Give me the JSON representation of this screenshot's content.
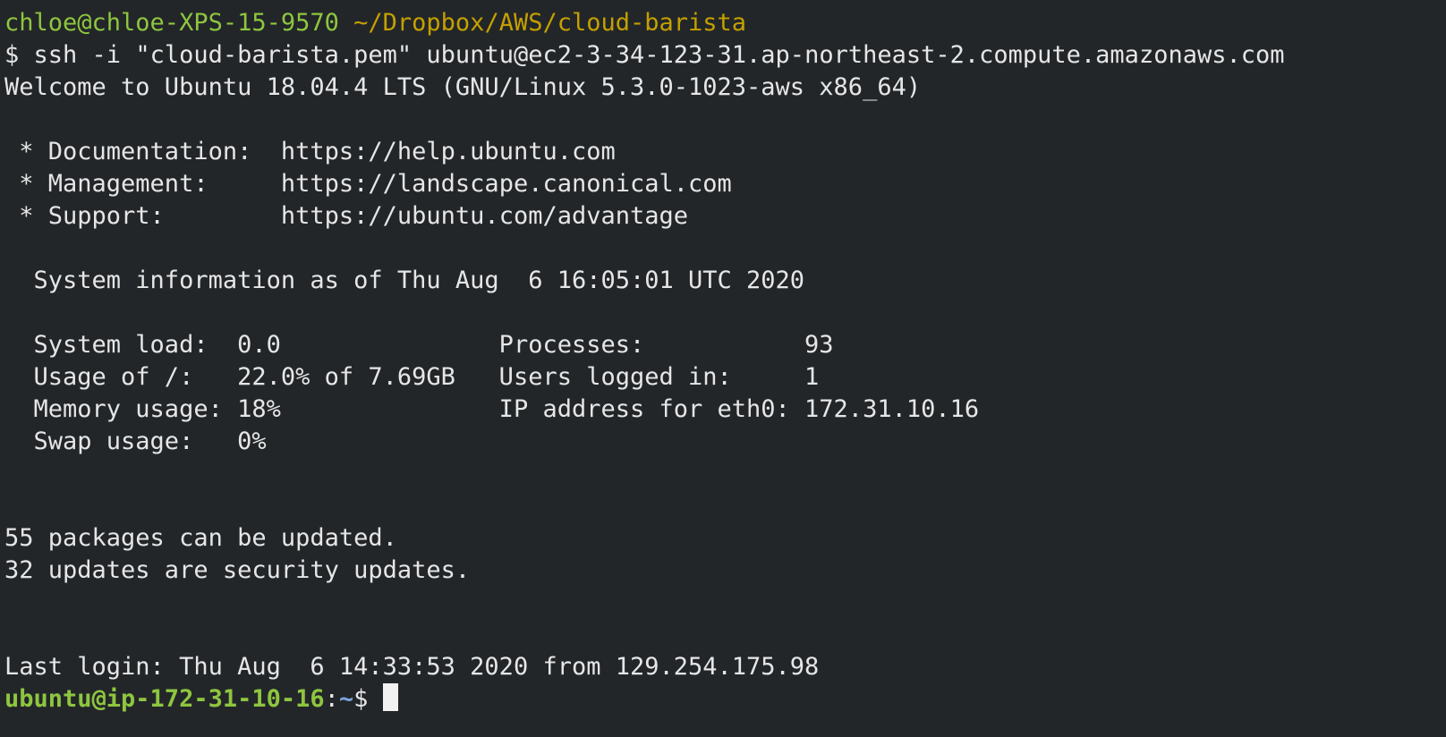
{
  "prompt_local": {
    "user_host": "chloe@chloe-XPS-15-9570",
    "path": "~/Dropbox/AWS/cloud-barista"
  },
  "command": {
    "symbol": "$",
    "text": "ssh -i \"cloud-barista.pem\" ubuntu@ec2-3-34-123-31.ap-northeast-2.compute.amazonaws.com"
  },
  "welcome": "Welcome to Ubuntu 18.04.4 LTS (GNU/Linux 5.3.0-1023-aws x86_64)",
  "links": [
    {
      "label": " * Documentation:  ",
      "url": "https://help.ubuntu.com"
    },
    {
      "label": " * Management:     ",
      "url": "https://landscape.canonical.com"
    },
    {
      "label": " * Support:        ",
      "url": "https://ubuntu.com/advantage"
    }
  ],
  "sysinfo_header": "  System information as of Thu Aug  6 16:05:01 UTC 2020",
  "sysinfo_rows": [
    "  System load:  0.0               Processes:           93",
    "  Usage of /:   22.0% of 7.69GB   Users logged in:     1",
    "  Memory usage: 18%               IP address for eth0: 172.31.10.16",
    "  Swap usage:   0%"
  ],
  "updates": [
    "55 packages can be updated.",
    "32 updates are security updates."
  ],
  "last_login": "Last login: Thu Aug  6 14:33:53 2020 from 129.254.175.98",
  "prompt_remote": {
    "user_host": "ubuntu@ip-172-31-10-16",
    "separator": ":",
    "path": "~",
    "symbol": "$ "
  },
  "colors": {
    "background": "#232629",
    "text": "#e6e6e6",
    "user_host": "#8ec63f",
    "path_local": "#c4a000",
    "path_remote": "#7aa6da"
  }
}
